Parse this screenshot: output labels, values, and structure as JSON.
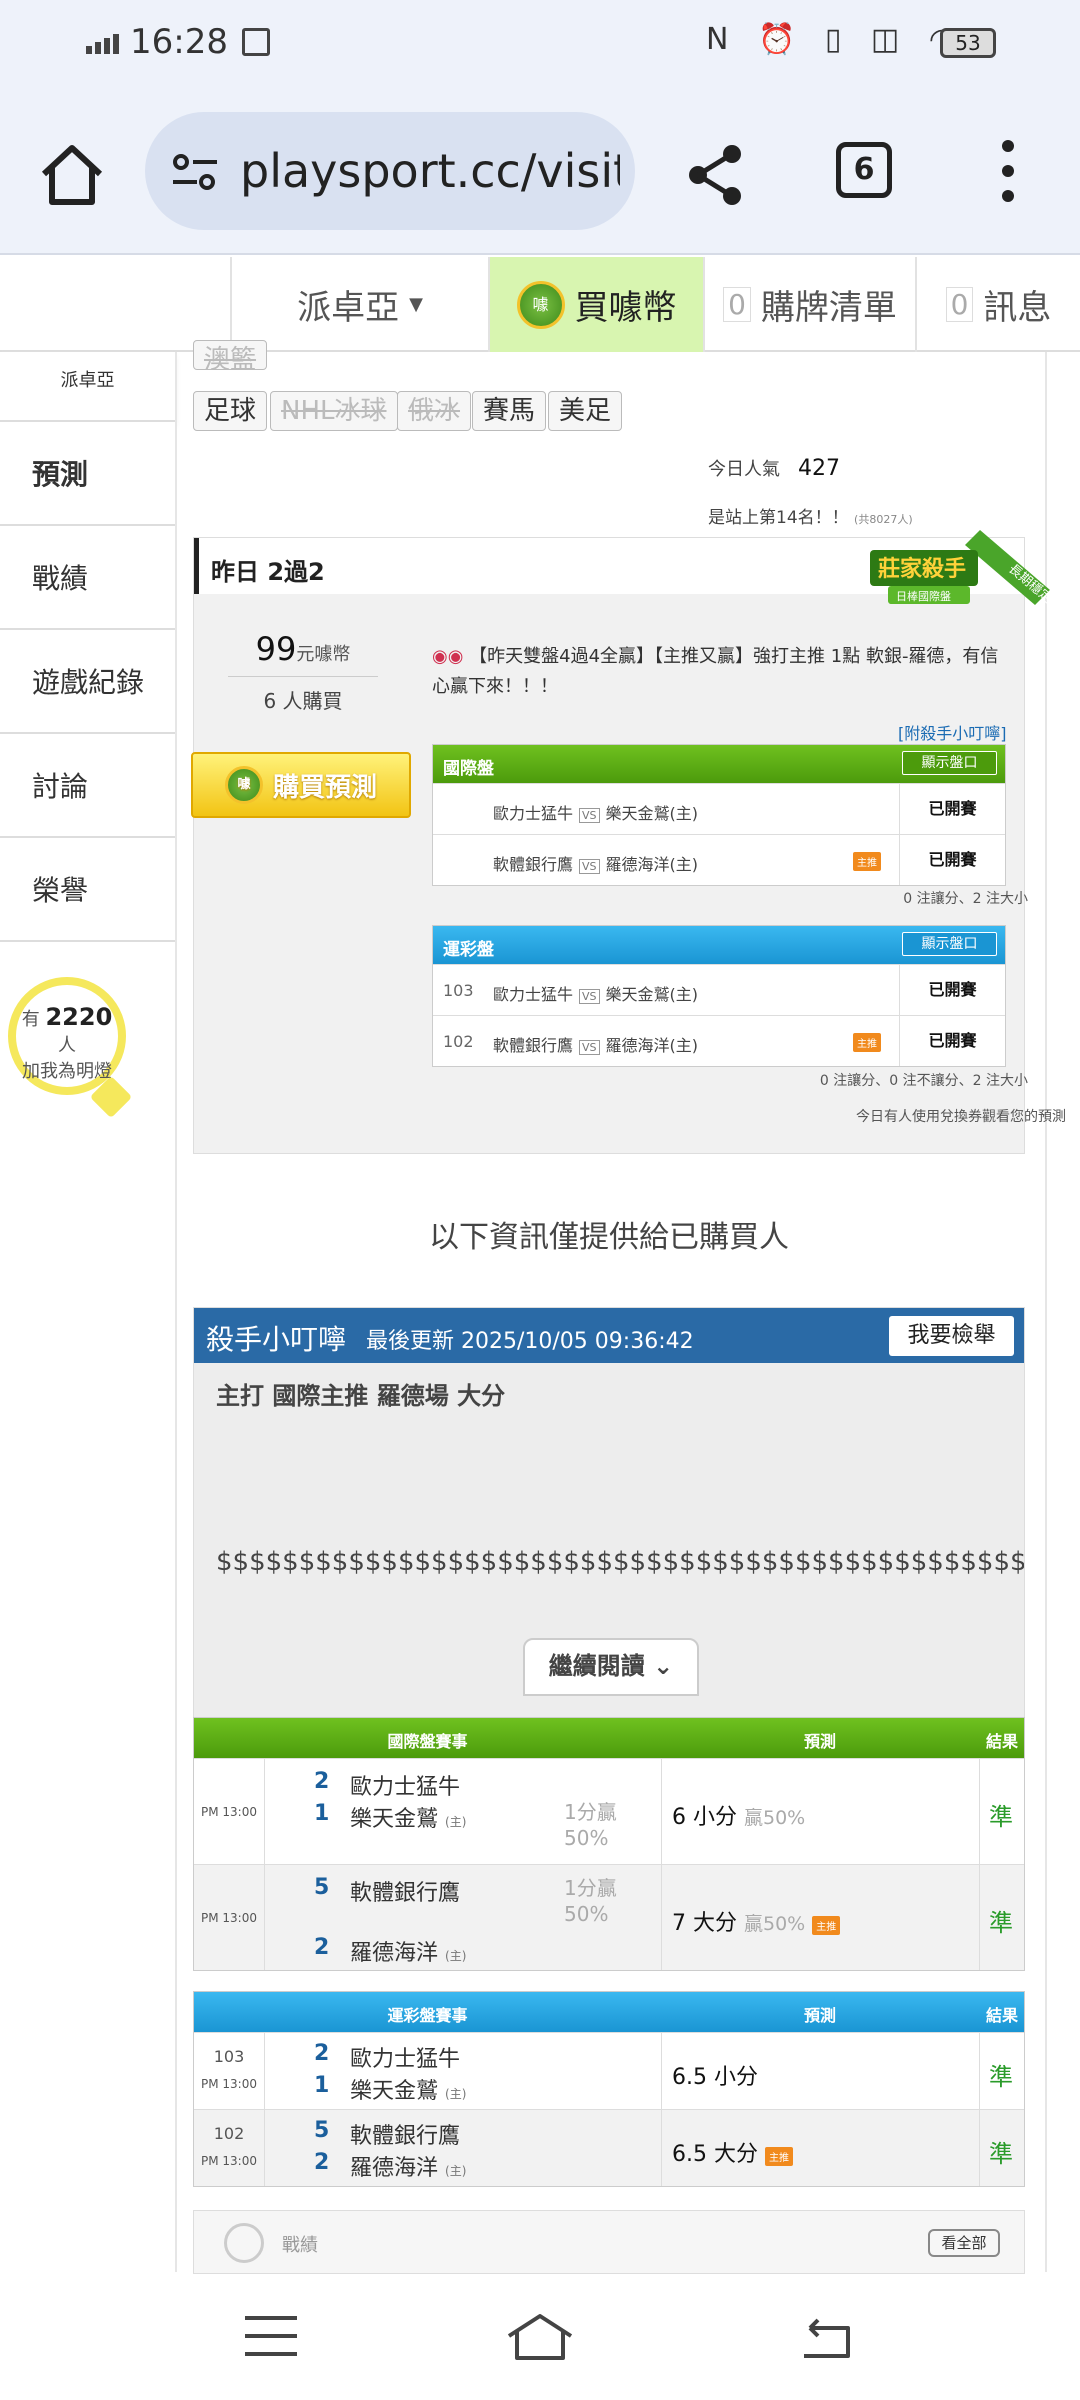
{
  "status": {
    "time": "16:28",
    "battery": "53"
  },
  "browser": {
    "url": "playsport.cc/visit",
    "tab_count": "6"
  },
  "site_nav": {
    "user": "派卓亞",
    "buy_coins": "買噱幣",
    "coin_symbol": "噱",
    "cart_count": "0",
    "cart": "購牌清單",
    "msg_count": "0",
    "messages": "訊息"
  },
  "sidebar": {
    "profile_name": "派卓亞",
    "items": [
      {
        "label": "預測"
      },
      {
        "label": "戰績"
      },
      {
        "label": "遊戲紀錄"
      },
      {
        "label": "討論"
      },
      {
        "label": "榮譽"
      }
    ],
    "followers_prefix": "有",
    "followers_count": "2220",
    "followers_suffix": "人",
    "followers_note": "加我為明燈"
  },
  "sport_tags": [
    "澳籃",
    "足球",
    "NHL冰球",
    "俄冰",
    "賽馬",
    "美足"
  ],
  "stats": {
    "popular_label": "今日人氣",
    "popular_value": "427",
    "rank_text": "是站上第14名！！",
    "rank_total": "(共8027人)"
  },
  "yesterday": {
    "header": "昨日 2過2",
    "badge_title": "莊家殺手",
    "badge_sub": "日棒國際盤",
    "badge_ribbon": "長期穩定",
    "price": "99",
    "price_unit": "元噱幣",
    "buyers": "6",
    "buyers_unit": "人購買",
    "buy_button": "購買預測",
    "prediction_text": "【昨天雙盤4過4全贏】【主推又贏】強打主推 1點 軟銀-羅德，有信心贏下來！！！",
    "attach_link": "[附殺手小叮嚀]",
    "intl": {
      "title": "國際盤",
      "show_btn": "顯示盤口",
      "rows": [
        {
          "num": "",
          "away": "歐力士猛牛",
          "home": "樂天金鷲(主)",
          "main_push": false,
          "status": "已開賽"
        },
        {
          "num": "",
          "away": "軟體銀行鷹",
          "home": "羅德海洋(主)",
          "main_push": true,
          "status": "已開賽"
        }
      ],
      "note": "0 注讓分、2 注大小"
    },
    "lottery": {
      "title": "運彩盤",
      "show_btn": "顯示盤口",
      "rows": [
        {
          "num": "103",
          "away": "歐力士猛牛",
          "home": "樂天金鷲(主)",
          "main_push": false,
          "status": "已開賽"
        },
        {
          "num": "102",
          "away": "軟體銀行鷹",
          "home": "羅德海洋(主)",
          "main_push": true,
          "status": "已開賽"
        }
      ],
      "note": "0 注讓分、0 注不讓分、2 注大小"
    },
    "exchange_note": "今日有人使用兌換券觀看您的預測",
    "main_push_label": "主推",
    "vs": "VS"
  },
  "info_text": "以下資訊僅提供給已購買人",
  "tips": {
    "title": "殺手小叮嚀",
    "updated": "最後更新 2025/10/05 09:36:42",
    "report_button": "我要檢舉",
    "line1": "主打 國際主推 羅德場 大分",
    "line2": "$$$$$$$$$$$$$$$$$$$$$$$$$$$$$$$$$$$$$$$$$$$$$$$$$$$$$$$$$$$$$$$$$",
    "continue": "繼續閱讀"
  },
  "intl_results": {
    "headers": [
      "國際盤賽事",
      "預測",
      "結果"
    ],
    "rows": [
      {
        "num": "",
        "time": "PM 13:00",
        "s1": "2",
        "t1": "歐力士猛牛",
        "t1_home": "",
        "s2": "1",
        "t2": "樂天金鷲",
        "t2_home": "(主)",
        "handicap": "1分贏 50%",
        "pred": "6 小分",
        "win": "贏50%",
        "main_push": false,
        "result": "準"
      },
      {
        "num": "",
        "time": "PM 13:00",
        "s1": "5",
        "t1": "軟體銀行鷹",
        "t1_home": "",
        "s2": "2",
        "t2": "羅德海洋",
        "t2_home": "(主)",
        "handicap": "1分贏 50%",
        "pred": "7 大分",
        "win": "贏50%",
        "main_push": true,
        "result": "準"
      }
    ]
  },
  "lottery_results": {
    "headers": [
      "運彩盤賽事",
      "預測",
      "結果"
    ],
    "rows": [
      {
        "num": "103",
        "time": "PM 13:00",
        "s1": "2",
        "t1": "歐力士猛牛",
        "s2": "1",
        "t2": "樂天金鷲",
        "t2_home": "(主)",
        "pred": "6.5 小分",
        "main_push": false,
        "result": "準"
      },
      {
        "num": "102",
        "time": "PM 13:00",
        "s1": "5",
        "t1": "軟體銀行鷹",
        "s2": "2",
        "t2": "羅德海洋",
        "t2_home": "(主)",
        "pred": "6.5 大分",
        "main_push": true,
        "result": "準"
      }
    ]
  },
  "record": {
    "label": "戰績",
    "view_all": "看全部"
  },
  "colors": {
    "green": "#4c9b0c",
    "blue": "#1a95d3",
    "dark_blue": "#2a6aa6",
    "result_green": "#2a9b2a",
    "push_orange": "#f18a1d"
  }
}
